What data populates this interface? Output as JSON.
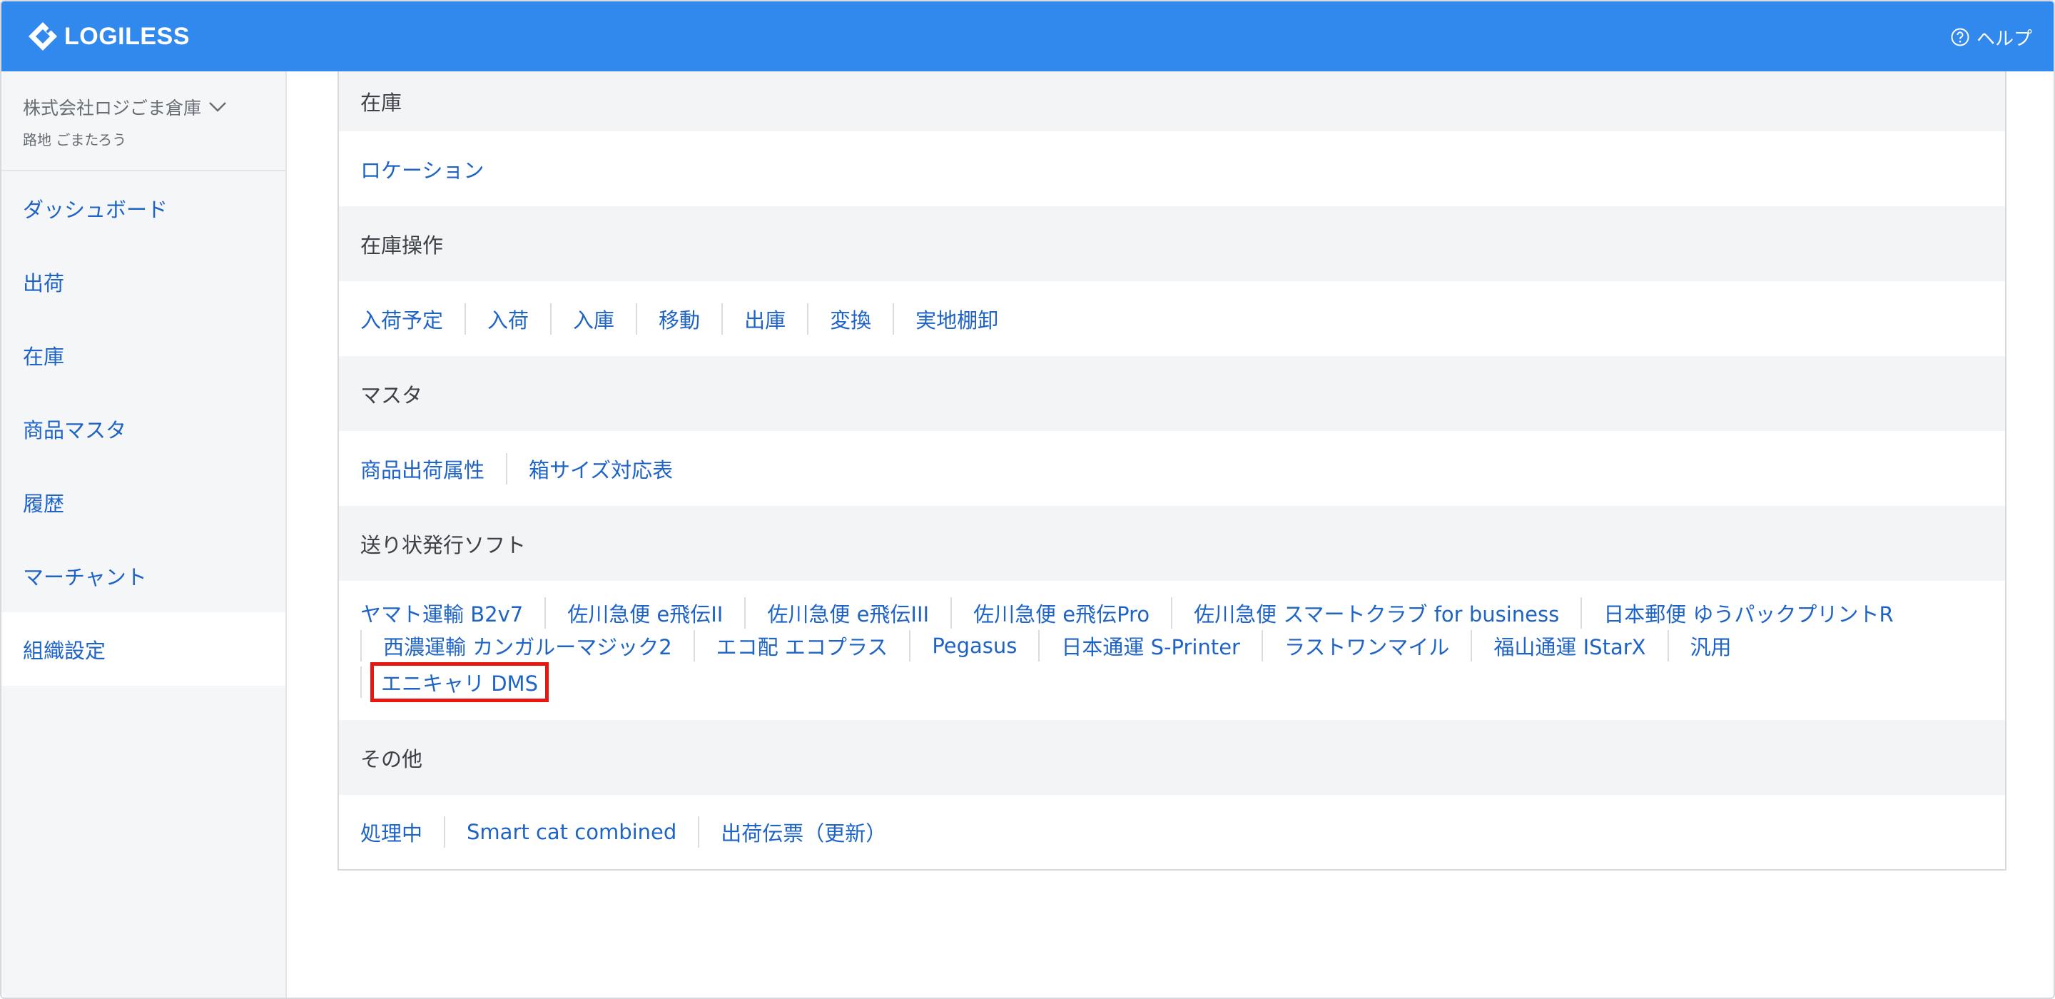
{
  "header": {
    "brand": "LOGILESS",
    "help_label": "ヘルプ"
  },
  "sidebar": {
    "org_name": "株式会社ロジごま倉庫",
    "user_name": "路地 ごまたろう",
    "items": [
      {
        "label": "ダッシュボード"
      },
      {
        "label": "出荷"
      },
      {
        "label": "在庫"
      },
      {
        "label": "商品マスタ"
      },
      {
        "label": "履歴"
      },
      {
        "label": "マーチャント"
      },
      {
        "label": "組織設定",
        "active": true
      }
    ]
  },
  "sections": {
    "inventory": {
      "title": "在庫",
      "links": [
        "ロケーション"
      ]
    },
    "inventory_ops": {
      "title": "在庫操作",
      "links": [
        "入荷予定",
        "入荷",
        "入庫",
        "移動",
        "出庫",
        "変換",
        "実地棚卸"
      ]
    },
    "master": {
      "title": "マスタ",
      "links": [
        "商品出荷属性",
        "箱サイズ対応表"
      ]
    },
    "label_software": {
      "title": "送り状発行ソフト",
      "links": [
        "ヤマト運輸 B2v7",
        "佐川急便 e飛伝II",
        "佐川急便 e飛伝III",
        "佐川急便 e飛伝Pro",
        "佐川急便 スマートクラブ for business",
        "日本郵便 ゆうパックプリントR",
        "西濃運輸 カンガルーマジック2",
        "エコ配 エコプラス",
        "Pegasus",
        "日本通運 S-Printer",
        "ラストワンマイル",
        "福山通運 IStarX",
        "汎用",
        "エニキャリ DMS"
      ]
    },
    "other": {
      "title": "その他",
      "links": [
        "処理中",
        "Smart cat combined",
        "出荷伝票（更新）"
      ]
    }
  },
  "colors": {
    "header_bg": "#3189ee",
    "link": "#1e63c6",
    "highlight_border": "#e8160f"
  }
}
